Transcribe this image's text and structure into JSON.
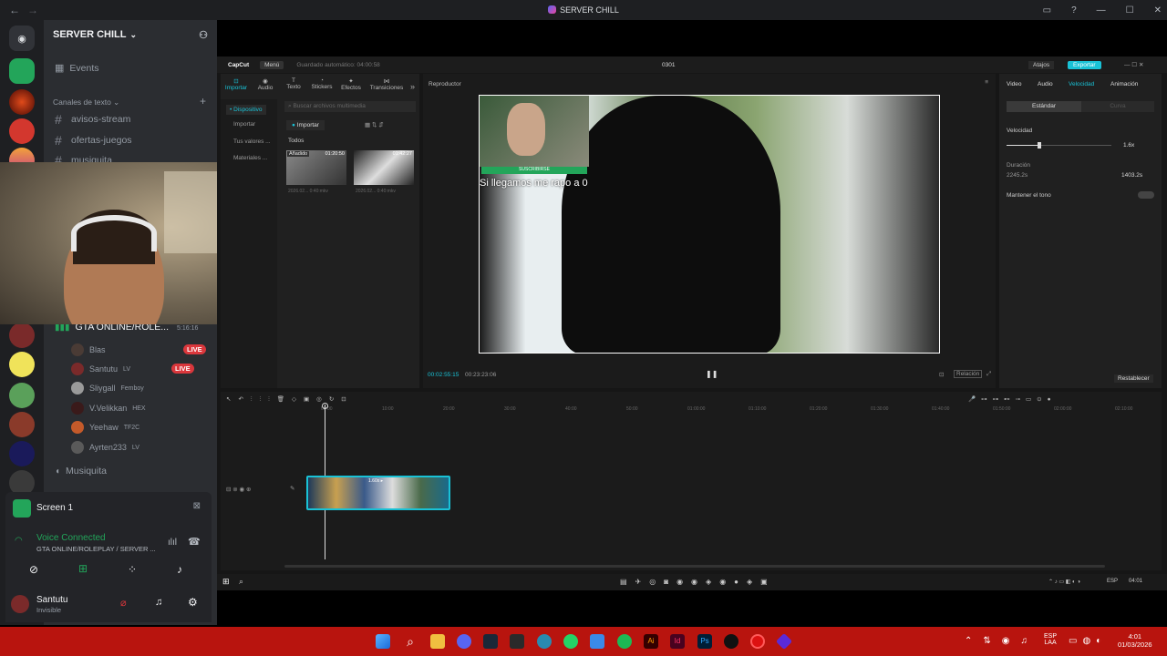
{
  "window": {
    "title": "SERVER CHILL"
  },
  "server": {
    "name": "SERVER CHILL",
    "events_label": "Events",
    "category": "Canales de texto",
    "text_channels": [
      "avisos-stream",
      "ofertas-juegos",
      "musiquita"
    ],
    "voice_channel": {
      "name": "GTA ONLINE/ROLE...",
      "timer": "5:16:16"
    },
    "voice_users": [
      {
        "name": "Blas",
        "badge": "LIVE"
      },
      {
        "name": "Santutu",
        "tag": "LV",
        "badge": "LIVE"
      },
      {
        "name": "Sliygall",
        "tag": "Femboy"
      },
      {
        "name": "V.Velikkan",
        "tag": "HEX"
      },
      {
        "name": "Yeehaw",
        "tag": "TF2C"
      },
      {
        "name": "Ayrten233",
        "tag": "LV"
      }
    ],
    "voice_channel_2": "Musiquita"
  },
  "stream_panel": {
    "label": "Screen 1"
  },
  "voice_status": {
    "status": "Voice Connected",
    "channel": "GTA ONLINE/ROLEPLAY / SERVER ..."
  },
  "user": {
    "name": "Santutu",
    "status": "Invisible"
  },
  "capcut": {
    "app_name": "CapCut",
    "menu_label": "Menú",
    "autosave": "Guardado automático: 04:00:58",
    "project_title": "0301",
    "shortcuts_label": "Atajos",
    "export_label": "Exportar",
    "media_tabs": [
      "Importar",
      "Audio",
      "Texto",
      "Stickers",
      "Efectos",
      "Transiciones"
    ],
    "left_nav": [
      "• Dispositivo",
      "Importar",
      "Tus valores ...",
      "Materiales ..."
    ],
    "search_placeholder": "Buscar archivos multimedia",
    "import_button": "Importar",
    "filter_all": "Todos",
    "clips": [
      {
        "badge": "Añadido",
        "duration": "01:20:50",
        "meta": "2026.02... 0:40:mkv"
      },
      {
        "badge": "",
        "duration": "01:42:27",
        "meta": "2026.02... 0:40:mkv"
      }
    ],
    "player_label": "Reproductor",
    "player_time_current": "00:02:55:15",
    "player_time_total": "00:23:23:06",
    "ratio_label": "Relación",
    "overlay_caption": "Si llegamos me rapo a 0",
    "subscribe_banner": "SUSCRIBIRSE",
    "props_tabs": [
      "Video",
      "Audio",
      "Velocidad",
      "Animación"
    ],
    "speed_modes": [
      "Estándar",
      "Curva"
    ],
    "speed_label": "Velocidad",
    "speed_value": "1.6x",
    "duration_label": "Duración",
    "duration_from": "2245.2s",
    "duration_to": "1403.2s",
    "keep_tone_label": "Mantener el tono",
    "reset_label": "Restablecer",
    "ruler_ticks": [
      "00:00",
      "10:00",
      "20:00",
      "30:00",
      "40:00",
      "50:00",
      "01:00:00",
      "01:10:00",
      "01:20:00",
      "01:30:00",
      "01:40:00",
      "01:50:00",
      "02:00:00",
      "02:10:00"
    ],
    "clip_label": "1.60x ▸"
  },
  "inner_taskbar": {
    "lang": "ESP",
    "time": "04:01"
  },
  "taskbar": {
    "lang_line1": "ESP",
    "lang_line2": "LAA",
    "time": "4:01",
    "date": "01/03/2026"
  },
  "colors": {
    "discord_bg": "#2b2d31",
    "live_red": "#da373c",
    "capcut_accent": "#19c2d6",
    "taskbar_red": "#b8140e",
    "voice_green": "#23a55a"
  }
}
